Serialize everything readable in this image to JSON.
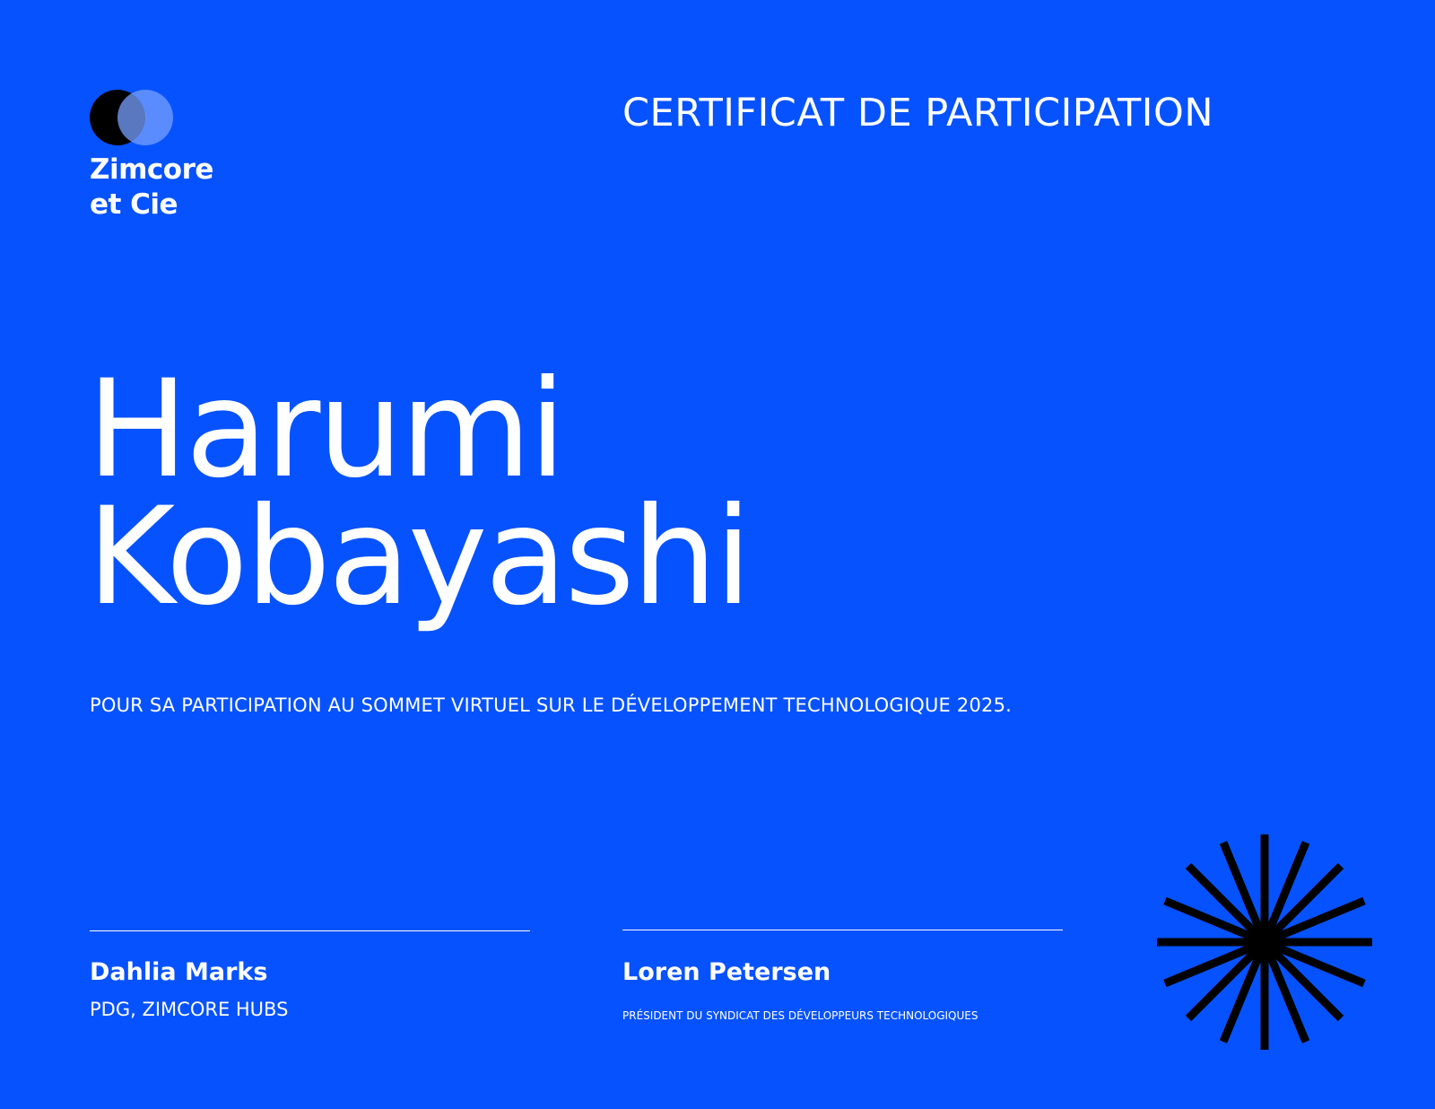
{
  "logo": {
    "icon": "overlapping-circles-icon",
    "name_line1": "Zimcore",
    "name_line2": "et Cie"
  },
  "certificate": {
    "title": "CERTIFICAT DE PARTICIPATION",
    "recipient_first": "Harumi",
    "recipient_last": "Kobayashi",
    "description": "POUR SA PARTICIPATION AU SOMMET VIRTUEL SUR LE DÉVELOPPEMENT TECHNOLOGIQUE 2025."
  },
  "signatures": [
    {
      "name": "Dahlia Marks",
      "title": "PDG, ZIMCORE HUBS"
    },
    {
      "name": "Loren Petersen",
      "title": "PRÉSIDENT DU SYNDICAT DES DÉVELOPPEURS TECHNOLOGIQUES"
    }
  ],
  "decoration": {
    "icon": "starburst-icon"
  },
  "colors": {
    "background": "#0652ff",
    "text": "#ffffff",
    "accent_dark": "#000000"
  }
}
